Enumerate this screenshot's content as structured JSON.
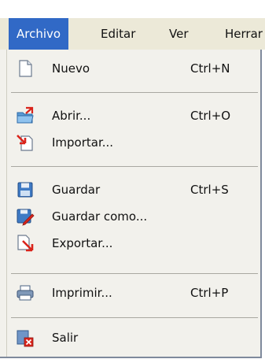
{
  "menubar": {
    "items": [
      {
        "label": "Archivo"
      },
      {
        "label": "Editar"
      },
      {
        "label": "Ver"
      },
      {
        "label": "Herrar"
      }
    ]
  },
  "file_menu": {
    "items": [
      {
        "label": "Nuevo",
        "shortcut": "Ctrl+N",
        "icon": "new-document-icon"
      },
      {
        "label": "Abrir...",
        "shortcut": "Ctrl+O",
        "icon": "open-folder-icon"
      },
      {
        "label": "Importar...",
        "shortcut": "",
        "icon": "import-icon"
      },
      {
        "label": "Guardar",
        "shortcut": "Ctrl+S",
        "icon": "save-icon"
      },
      {
        "label": "Guardar como...",
        "shortcut": "",
        "icon": "save-as-icon"
      },
      {
        "label": "Exportar...",
        "shortcut": "",
        "icon": "export-icon"
      },
      {
        "label": "Imprimir...",
        "shortcut": "Ctrl+P",
        "icon": "printer-icon"
      },
      {
        "label": "Salir",
        "shortcut": "",
        "icon": "exit-icon"
      }
    ]
  },
  "colors": {
    "menu_highlight": "#3169c6",
    "menu_background": "#f2f1ec",
    "menubar_background": "#ece9d8"
  }
}
